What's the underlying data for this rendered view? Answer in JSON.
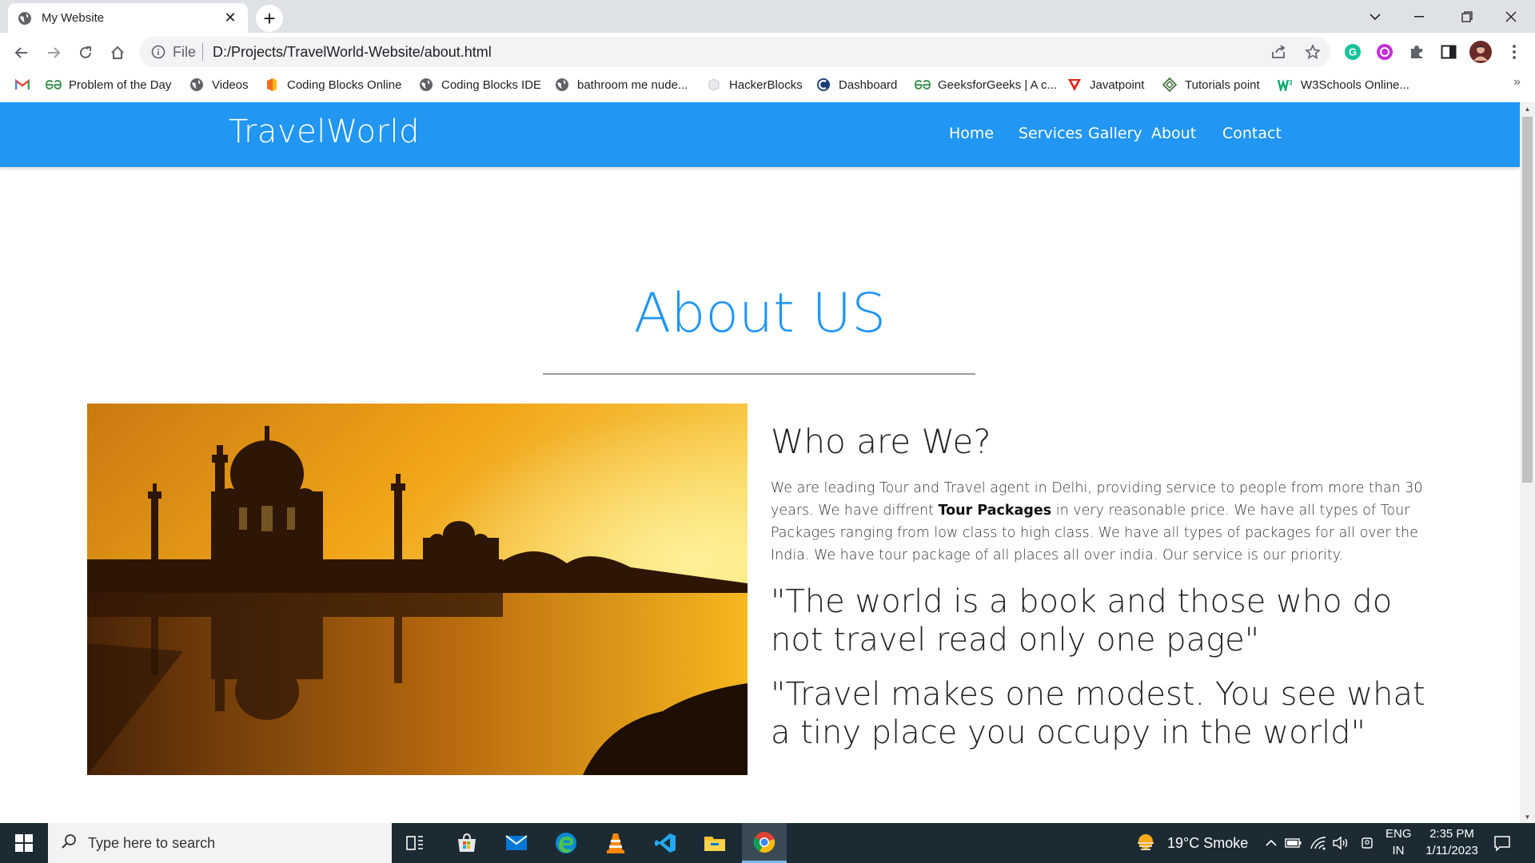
{
  "browser": {
    "tab_title": "My Website",
    "address_scheme": "File",
    "address_url": "D:/Projects/TravelWorld-Website/about.html"
  },
  "bookmarks": [
    {
      "label": "Problem of the Day",
      "icon": "gfg-icon"
    },
    {
      "label": "Videos",
      "icon": "globe-icon"
    },
    {
      "label": "Coding Blocks Online",
      "icon": "coding-blocks-icon"
    },
    {
      "label": "Coding Blocks IDE",
      "icon": "globe-icon"
    },
    {
      "label": "bathroom me nude...",
      "icon": "globe-icon"
    },
    {
      "label": "HackerBlocks",
      "icon": "hackerblocks-icon"
    },
    {
      "label": "Dashboard",
      "icon": "dashboard-icon"
    },
    {
      "label": "GeeksforGeeks | A c...",
      "icon": "gfg-icon"
    },
    {
      "label": "Javatpoint",
      "icon": "javatpoint-icon"
    },
    {
      "label": "Tutorials point",
      "icon": "tutorialspoint-icon"
    },
    {
      "label": "W3Schools Online...",
      "icon": "w3schools-icon"
    }
  ],
  "site": {
    "brand": "TravelWorld",
    "nav": [
      "Home",
      "Services",
      "Gallery",
      "About",
      "Contact"
    ],
    "heading": "About US",
    "subheading": "Who are We?",
    "para_1": "We are leading Tour and Travel agent in Delhi, providing service to people from more than 30 years. We have diffrent ",
    "para_bold": "Tour Packages",
    "para_2": " in very reasonable price. We have all types of Tour Packages ranging from low class to high class. We have all types of packages for all over the India. We have tour package of all places all over india. Our service is our priority.",
    "quote_1": "\"The world is a book and those who do not travel read only one page\"",
    "quote_2": "\"Travel makes one modest. You see what a tiny place you occupy in the world\""
  },
  "taskbar": {
    "search_placeholder": "Type here to search",
    "weather": "19°C  Smoke",
    "lang_1": "ENG",
    "lang_2": "IN",
    "time": "2:35 PM",
    "date": "1/11/2023"
  },
  "colors": {
    "accent": "#2196f3",
    "nav_text": "#ffffff",
    "taskbar": "#1c2b33"
  }
}
